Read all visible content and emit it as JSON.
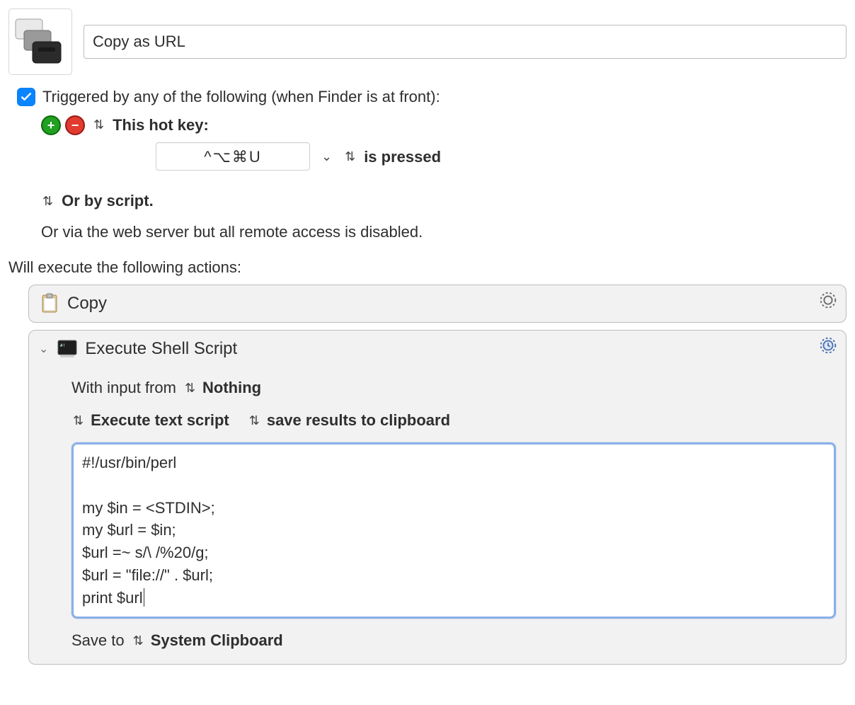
{
  "header": {
    "macro_name": "Copy as URL"
  },
  "trigger": {
    "enabled_label": "Triggered by any of the following (when Finder is at front):",
    "hotkey_row": {
      "label": "This hot key:",
      "hotkey": "^⌥⌘U",
      "when": "is pressed"
    },
    "or_script": "Or by script.",
    "or_web": "Or via the web server but all remote access is disabled."
  },
  "actions_intro": "Will execute the following actions:",
  "actions": {
    "copy": {
      "title": "Copy"
    },
    "shell": {
      "title": "Execute Shell Script",
      "input_label": "With input from",
      "input_value": "Nothing",
      "mode_label": "Execute text script",
      "results_label": "save results to clipboard",
      "script_text": "#!/usr/bin/perl\n\nmy $in = <STDIN>;\nmy $url = $in;\n$url =~ s/\\ /%20/g;\n$url = \"file://\" . $url;\nprint $url",
      "save_to_label": "Save to",
      "save_to_value": "System Clipboard"
    }
  }
}
